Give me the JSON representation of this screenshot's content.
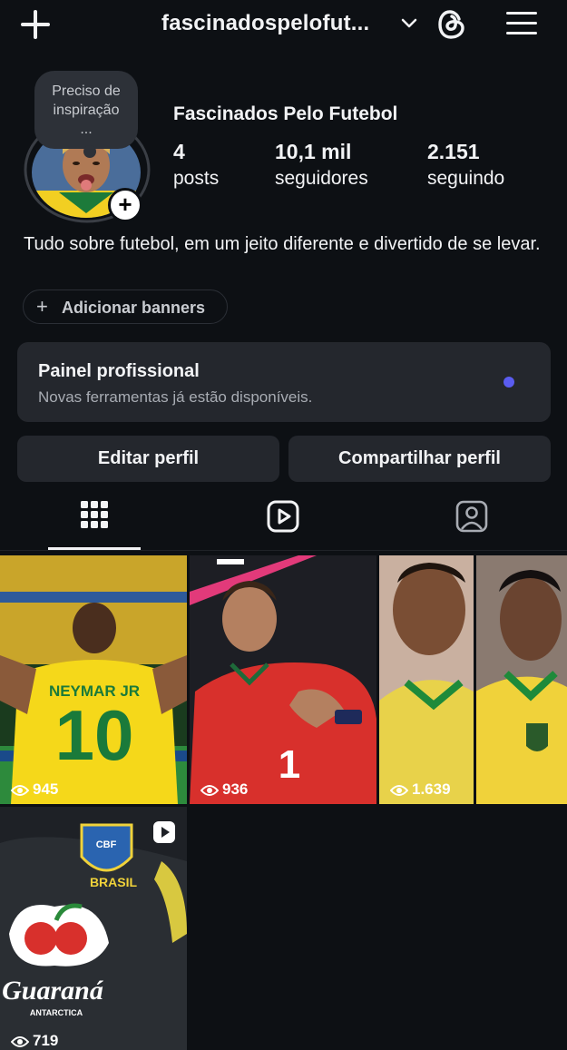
{
  "header": {
    "username": "fascinadospelofut..."
  },
  "profile": {
    "note": [
      "Preciso de",
      "inspiração",
      "..."
    ],
    "name": "Fascinados Pelo Futebol",
    "stats": [
      {
        "num": "4",
        "label": "posts"
      },
      {
        "num": "10,1 mil",
        "label": "seguidores"
      },
      {
        "num": "2.151",
        "label": "seguindo"
      }
    ],
    "bio": "Tudo sobre futebol, em um jeito diferente e divertido de se levar.",
    "add_banners": "Adicionar banners"
  },
  "panel": {
    "title": "Painel profissional",
    "subtitle": "Novas ferramentas já estão disponíveis."
  },
  "actions": {
    "edit": "Editar perfil",
    "share": "Compartilhar perfil"
  },
  "posts": [
    {
      "views": "945",
      "jersey_name": "NEYMAR JR",
      "jersey_number": "10"
    },
    {
      "views": "936",
      "jersey_number": "1"
    },
    {
      "views": "1.639"
    },
    {
      "views": "719",
      "crest": "CBF",
      "country": "BRASIL",
      "sponsor": "Guaraná",
      "sponsor_sub": "ANTARCTICA"
    }
  ],
  "colors": {
    "background": "#0d1014",
    "card": "#24272d",
    "accent_dot": "#5a5cf0",
    "text": "#f2f3f5",
    "muted": "#a8acb3"
  },
  "icons": [
    "plus-icon",
    "chevron-down-icon",
    "threads-icon",
    "hamburger-menu-icon",
    "grid-icon",
    "reels-icon",
    "tagged-icon",
    "eye-icon",
    "reel-badge-icon"
  ]
}
